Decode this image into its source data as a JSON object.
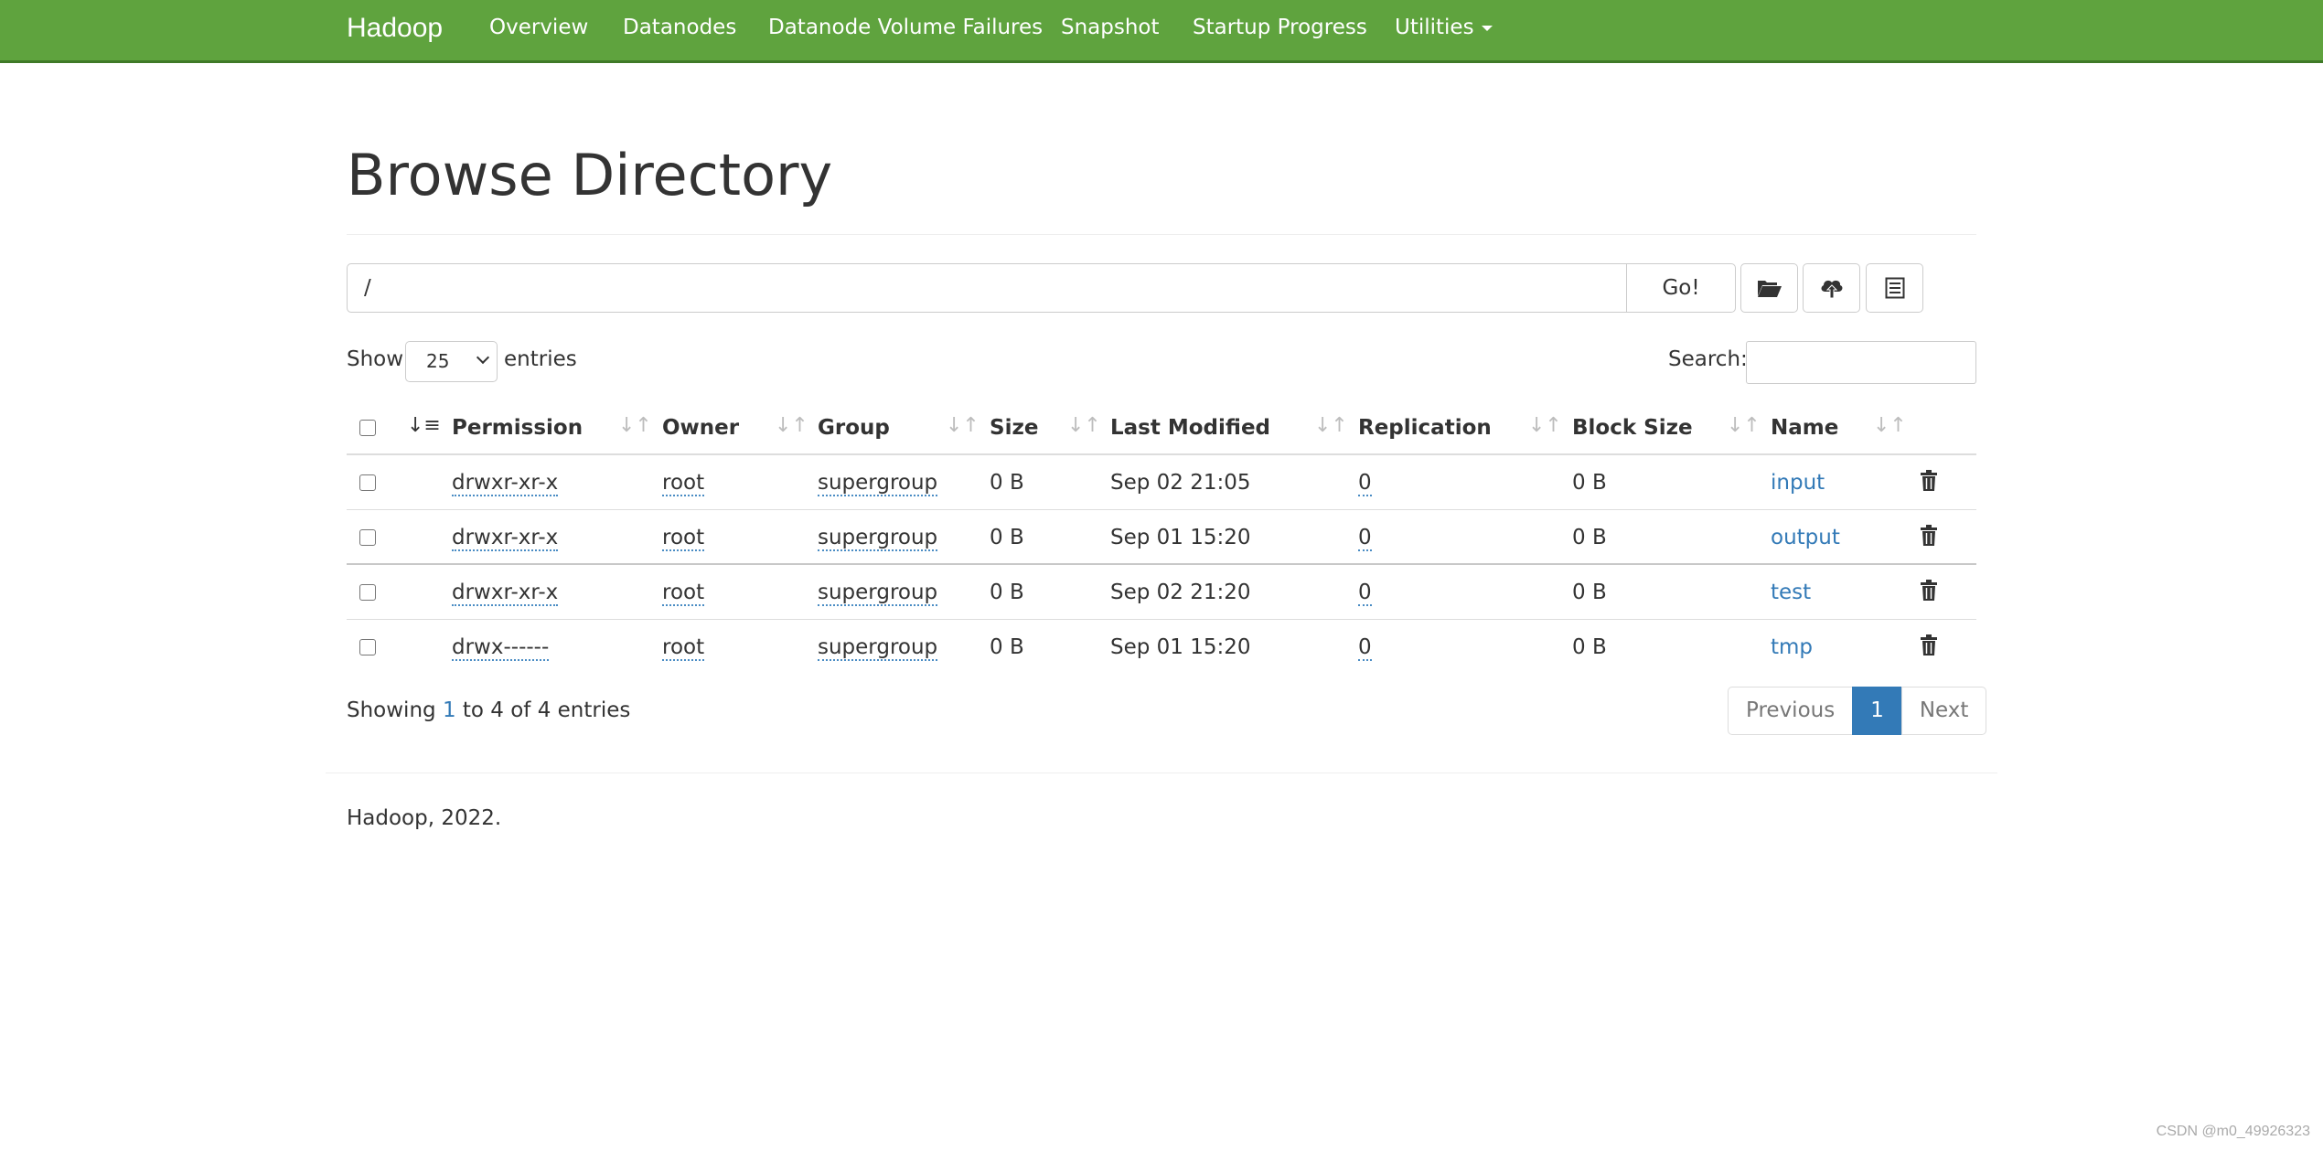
{
  "navbar": {
    "brand": "Hadoop",
    "items": [
      "Overview",
      "Datanodes",
      "Datanode Volume Failures",
      "Snapshot",
      "Startup Progress",
      "Utilities"
    ],
    "color": "#5fa33e"
  },
  "page": {
    "title": "Browse Directory"
  },
  "path_bar": {
    "path": "/",
    "go_label": "Go!",
    "tool_icons": [
      "open-folder-icon",
      "upload-cloud-icon",
      "list-icon"
    ]
  },
  "table_controls": {
    "show_label": "Show",
    "page_length": "25",
    "entries_label": "entries",
    "search_label": "Search:",
    "search_value": ""
  },
  "table": {
    "columns": [
      "Permission",
      "Owner",
      "Group",
      "Size",
      "Last Modified",
      "Replication",
      "Block Size",
      "Name"
    ],
    "rows": [
      {
        "permission": "drwxr-xr-x",
        "owner": "root",
        "group": "supergroup",
        "size": "0 B",
        "modified": "Sep 02 21:05",
        "replication": "0",
        "block_size": "0 B",
        "name": "input"
      },
      {
        "permission": "drwxr-xr-x",
        "owner": "root",
        "group": "supergroup",
        "size": "0 B",
        "modified": "Sep 01 15:20",
        "replication": "0",
        "block_size": "0 B",
        "name": "output"
      },
      {
        "permission": "drwxr-xr-x",
        "owner": "root",
        "group": "supergroup",
        "size": "0 B",
        "modified": "Sep 02 21:20",
        "replication": "0",
        "block_size": "0 B",
        "name": "test"
      },
      {
        "permission": "drwx------",
        "owner": "root",
        "group": "supergroup",
        "size": "0 B",
        "modified": "Sep 01 15:20",
        "replication": "0",
        "block_size": "0 B",
        "name": "tmp"
      }
    ]
  },
  "table_info": {
    "prefix": "Showing ",
    "start": "1",
    "middle": " to 4 of 4 entries"
  },
  "pagination": {
    "previous": "Previous",
    "current": "1",
    "next": "Next",
    "active_color": "#337ab7"
  },
  "footer": {
    "text": "Hadoop, 2022."
  },
  "watermark": "CSDN @m0_49926323"
}
